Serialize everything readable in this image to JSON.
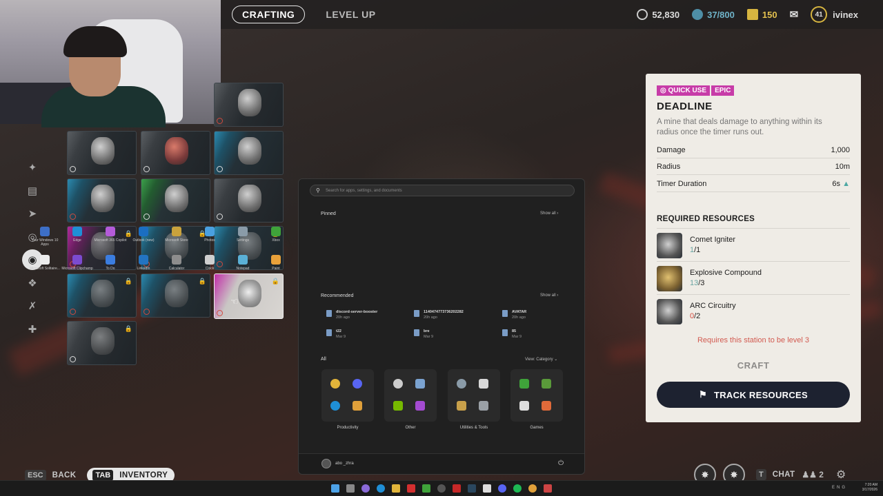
{
  "topbar": {
    "tabs": [
      "CRAFTING",
      "LEVEL UP"
    ],
    "coins": "52,830",
    "stash": "37/800",
    "tokens": "150",
    "level": "41",
    "username": "ivinex"
  },
  "start_menu": {
    "search_placeholder": "Search for apps, settings, and documents",
    "pinned_label": "Pinned",
    "show_all": "Show all",
    "pinned": [
      {
        "label": "Your Windows 10 Apps",
        "color": "#3d6fc7"
      },
      {
        "label": "Edge",
        "color": "#1f8fd6"
      },
      {
        "label": "Microsoft 365 Copilot",
        "color": "#b45bd9"
      },
      {
        "label": "Outlook (new)",
        "color": "#1b6ec2"
      },
      {
        "label": "Microsoft Store",
        "color": "#c9a23c"
      },
      {
        "label": "Photos",
        "color": "#4aa0e0"
      },
      {
        "label": "Settings",
        "color": "#8a9ba8"
      },
      {
        "label": "Xbox",
        "color": "#3fa33a"
      },
      {
        "label": "Microsoft Solitaire...",
        "color": "#ededed"
      },
      {
        "label": "Microsoft Clipchamp",
        "color": "#7c4bd1"
      },
      {
        "label": "To Do",
        "color": "#3b7de0"
      },
      {
        "label": "LinkedIn",
        "color": "#2374c2"
      },
      {
        "label": "Calculator",
        "color": "#8d8d8d"
      },
      {
        "label": "Clock",
        "color": "#cfcfcf"
      },
      {
        "label": "Notepad",
        "color": "#5ab0d6"
      },
      {
        "label": "Paint",
        "color": "#e8a13a"
      }
    ],
    "recommended_label": "Recommended",
    "recommended": [
      {
        "name": "discord-server-booster",
        "time": "20h ago"
      },
      {
        "name": "1140474773736202282",
        "time": "20h ago"
      },
      {
        "name": "AVATAR",
        "time": "20h ago"
      },
      {
        "name": "t22",
        "time": "Mar 9"
      },
      {
        "name": "bre",
        "time": "Mar 9"
      },
      {
        "name": "85",
        "time": "Mar 9"
      }
    ],
    "all_label": "All",
    "view_category": "View: Category",
    "categories": [
      "Productivity",
      "Other",
      "Utilities & Tools",
      "Games"
    ],
    "user": "abo _zhra"
  },
  "item": {
    "badges": [
      "QUICK USE",
      "EPIC"
    ],
    "badge_color": "#c73ca8",
    "name": "DEADLINE",
    "description": "A mine that deals damage to anything within its radius once the timer runs out.",
    "stats": [
      {
        "label": "Damage",
        "value": "1,000"
      },
      {
        "label": "Radius",
        "value": "10m"
      },
      {
        "label": "Timer Duration",
        "value": "6s"
      }
    ],
    "required_title": "REQUIRED RESOURCES",
    "resources": [
      {
        "name": "Comet Igniter",
        "have": "1",
        "need": "/1"
      },
      {
        "name": "Explosive Compound",
        "have": "13",
        "need": "/3"
      },
      {
        "name": "ARC Circuitry",
        "have": "0",
        "need": "/2"
      }
    ],
    "requirement": "Requires this station to be level 3",
    "craft_label": "CRAFT",
    "track_label": "TRACK RESOURCES"
  },
  "bottom": {
    "esc_key": "ESC",
    "back": "BACK",
    "tab_key": "TAB",
    "inventory": "INVENTORY",
    "chat_key": "T",
    "chat": "CHAT",
    "party_count": "2"
  },
  "taskbar": {
    "lang": "ENG",
    "time": "7:20 AM",
    "date": "3/17/2026"
  }
}
